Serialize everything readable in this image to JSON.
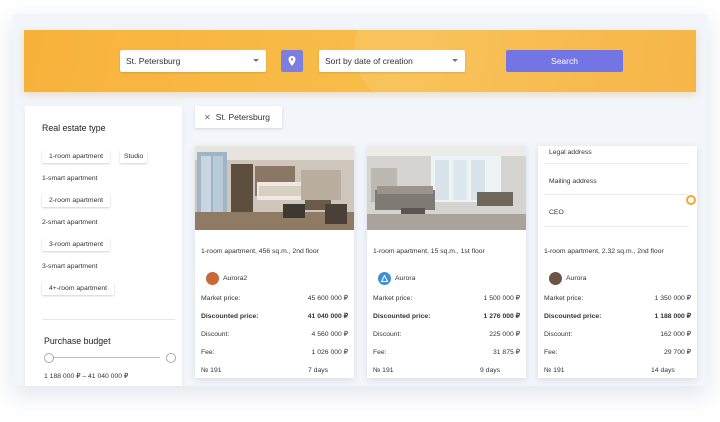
{
  "search_bar": {
    "city": "St. Petersburg",
    "sort": "Sort by date of creation",
    "search_label": "Search"
  },
  "sidebar": {
    "heading": "Real estate type",
    "types": [
      "1-room apartment",
      "Studio",
      "1-smart apartment",
      "2-room apartment",
      "2-smart apartment",
      "3-room apartment",
      "3-smart apartment",
      "4+-room apartment"
    ],
    "budget_heading": "Purchase budget",
    "budget_range": "1 188 000 ₽ – 41 040 000 ₽"
  },
  "active_filter": "St. Petersburg",
  "cards": [
    {
      "title": "1-room apartment,  456 sq.m., 2nd floor",
      "author": "Aurora2",
      "rows": [
        {
          "label": "Market price:",
          "value": "45 600 000 ₽"
        },
        {
          "label": "Discounted price:",
          "value": "41 040 000 ₽"
        },
        {
          "label": "Discount:",
          "value": "4 560 000 ₽"
        },
        {
          "label": "Fee:",
          "value": "1 026 000 ₽"
        },
        {
          "label": "№ 191",
          "value": "7 days"
        }
      ]
    },
    {
      "title": "1-room apartment,  15 sq.m., 1st floor",
      "author": "Aurora",
      "rows": [
        {
          "label": "Market price:",
          "value": "1 500 000 ₽"
        },
        {
          "label": "Discounted price:",
          "value": "1 276 000 ₽"
        },
        {
          "label": "Discount:",
          "value": "225 000 ₽"
        },
        {
          "label": "Fee:",
          "value": "31 875 ₽"
        },
        {
          "label": "№ 191",
          "value": "9 days"
        }
      ]
    },
    {
      "menu": [
        "Legal address",
        "Mailing address",
        "CEO"
      ],
      "title": "1-room apartment,  2.32 sq.m., 2nd floor",
      "author": "Aurora",
      "rows": [
        {
          "label": "Market price:",
          "value": "1 350 000 ₽"
        },
        {
          "label": "Discounted price:",
          "value": "1 188 000 ₽"
        },
        {
          "label": "Discount:",
          "value": "162 000 ₽"
        },
        {
          "label": "Fee:",
          "value": "29 700 ₽"
        },
        {
          "label": "№ 191",
          "value": "14 days"
        }
      ]
    }
  ],
  "colors": {
    "accent_orange": "#f7b23b",
    "accent_purple": "#7375e4"
  }
}
